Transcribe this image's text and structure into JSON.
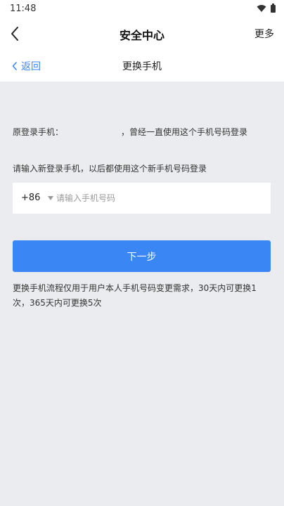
{
  "status_bar": {
    "time": "11:48",
    "icons": [
      "wifi-icon",
      "battery-icon"
    ]
  },
  "app_bar": {
    "title": "安全中心",
    "more_label": "更多",
    "back_icon": "chevron-left-icon"
  },
  "sub_bar": {
    "back_label": "返回",
    "title": "更换手机"
  },
  "current_phone": {
    "label": "原登录手机：",
    "suffix": "，曾经一直使用这个手机号码登录"
  },
  "new_phone": {
    "instruction": "请输入新登录手机，以后都使用这个新手机号码登录",
    "country_code": "+86",
    "placeholder": "请输入手机号码",
    "value": ""
  },
  "next_button": {
    "label": "下一步"
  },
  "notice": {
    "text": "更换手机流程仅用于用户本人手机号码变更需求，30天内可更换1次，365天内可更换5次"
  },
  "colors": {
    "accent": "#3a86f5",
    "background": "#ebecef",
    "surface": "#ffffff"
  }
}
